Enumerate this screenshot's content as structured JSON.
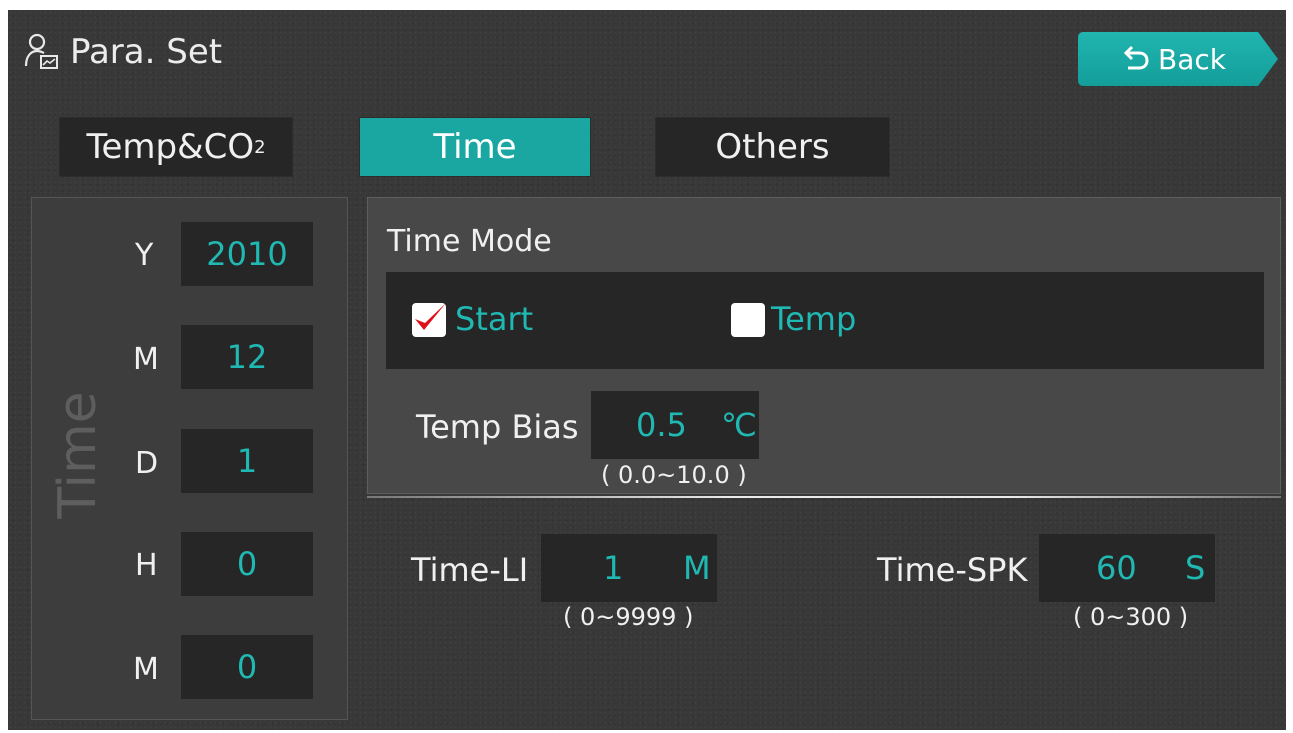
{
  "header": {
    "title": "Para. Set",
    "back_label": "Back"
  },
  "tabs": [
    {
      "label": "Temp&CO",
      "sub": "2",
      "active": false
    },
    {
      "label": "Time",
      "active": true
    },
    {
      "label": "Others",
      "active": false
    }
  ],
  "time_panel": {
    "vertical_label": "Time",
    "fields": [
      {
        "label": "Y",
        "value": "2010"
      },
      {
        "label": "M",
        "value": "12"
      },
      {
        "label": "D",
        "value": "1"
      },
      {
        "label": "H",
        "value": "0"
      },
      {
        "label": "M",
        "value": "0"
      }
    ]
  },
  "time_mode": {
    "title": "Time Mode",
    "options": [
      {
        "label": "Start",
        "checked": true
      },
      {
        "label": "Temp",
        "checked": false
      }
    ],
    "temp_bias": {
      "label": "Temp Bias",
      "value": "0.5",
      "unit": "℃",
      "range": "( 0.0~10.0 )"
    }
  },
  "time_li": {
    "label": "Time-LI",
    "value": "1",
    "unit": "M",
    "range": "( 0~9999 )"
  },
  "time_spk": {
    "label": "Time-SPK",
    "value": "60",
    "unit": "S",
    "range": "( 0~300 )"
  },
  "colors": {
    "accent": "#1aa7a2",
    "value_text": "#20b8b2",
    "background": "#383838",
    "check_mark": "#e0101a"
  }
}
